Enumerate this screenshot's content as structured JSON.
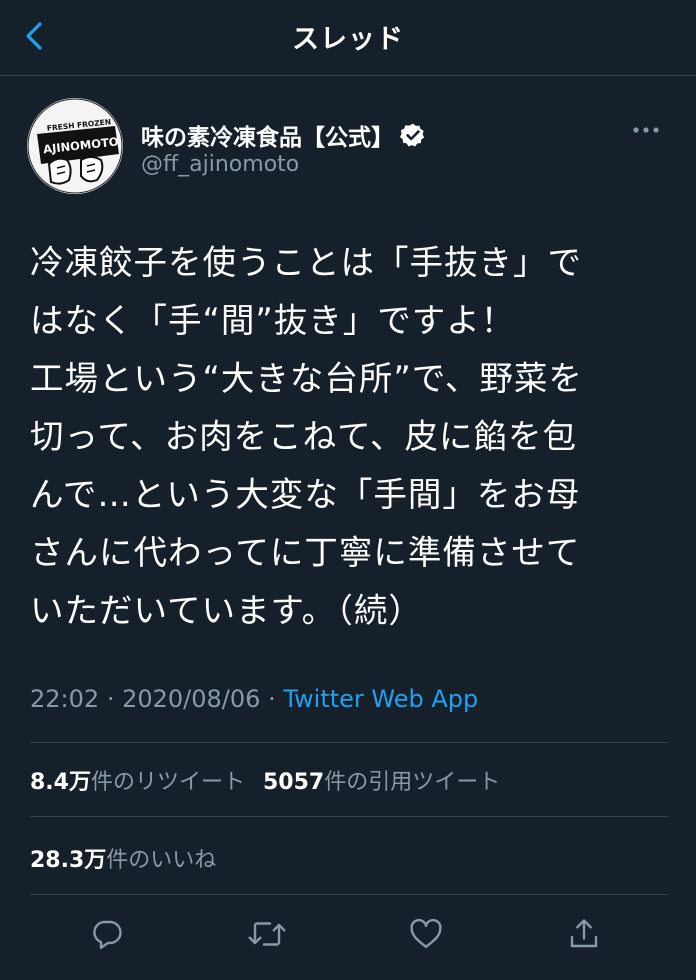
{
  "header": {
    "title": "スレッド"
  },
  "author": {
    "display_name": "味の素冷凍食品【公式】",
    "handle": "@ff_ajinomoto",
    "verified": true,
    "avatar_text_top": "FRESH FROZEN",
    "avatar_text_bottom": "AJINOMOTO"
  },
  "tweet": {
    "text": "冷凍餃子を使うことは「手抜き」で\nはなく「手“間”抜き」ですよ！\n工場という“大きな台所”で、野菜を\n切って、お肉をこねて、皮に餡を包\nんで…という大変な「手間」をお母\nさんに代わってに丁寧に準備させて\nいただいています。（続）",
    "time": "22:02",
    "separator": "·",
    "date": "2020/08/06",
    "source": "Twitter Web App"
  },
  "stats": {
    "retweets_count": "8.4万",
    "retweets_label": "件のリツイート",
    "quotes_count": "5057",
    "quotes_label": "件の引用ツイート",
    "likes_count": "28.3万",
    "likes_label": "件のいいね"
  },
  "icons": {
    "back": "chevron-left-icon",
    "more": "more-horizontal-icon",
    "verified": "verified-badge-icon",
    "reply": "reply-icon",
    "retweet": "retweet-icon",
    "like": "heart-icon",
    "share": "share-icon"
  },
  "colors": {
    "background": "#15202b",
    "accent": "#1da1f2",
    "secondary_text": "#8899a6",
    "divider": "#38444d"
  }
}
